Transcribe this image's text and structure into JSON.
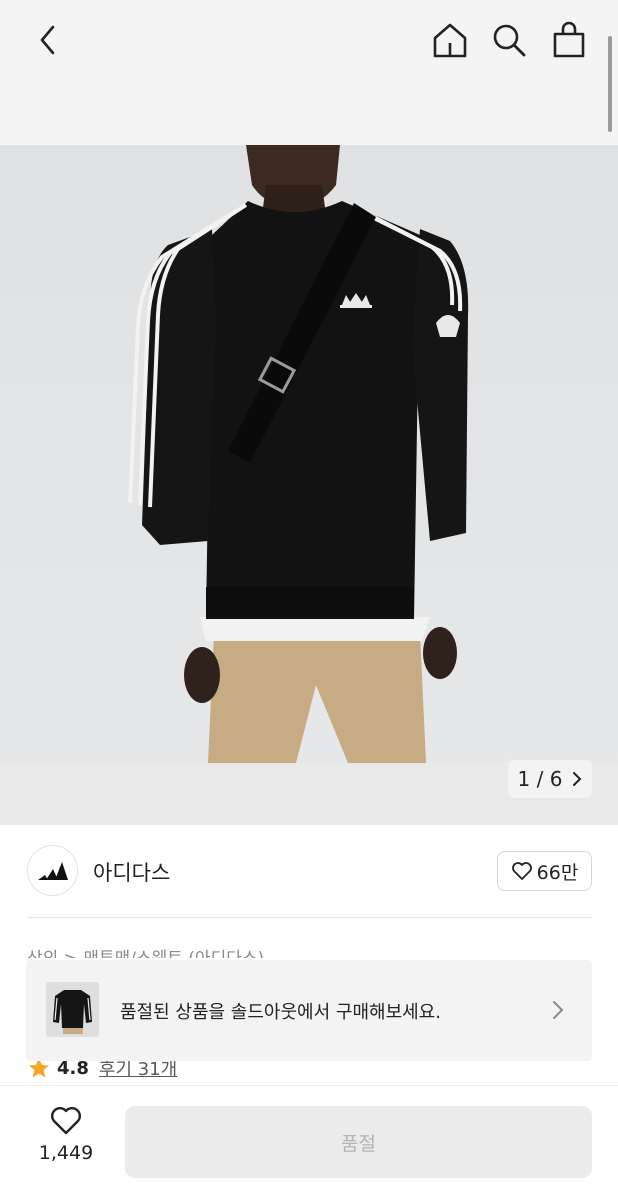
{
  "header": {
    "back_icon": "chevron-left-icon",
    "home_icon": "home-icon",
    "search_icon": "search-icon",
    "bag_icon": "shopping-bag-icon"
  },
  "product_image": {
    "description_icon": "product-photo",
    "counter": "1 / 6"
  },
  "brand": {
    "name": "아디다스",
    "like_count": "66만",
    "logo_icon": "adidas-logo-icon"
  },
  "breadcrumb": {
    "text": "상의 > 맨투맨/스웨트 (아디다스)"
  },
  "rating": {
    "value": "4.8",
    "reviews": "후기 31개",
    "star_color": "#f5a623"
  },
  "soldout_banner": {
    "text": "품절된 상품을 솔드아웃에서 구매해보세요."
  },
  "bottom_bar": {
    "wish_count": "1,449",
    "buy_label": "품절"
  },
  "colors": {
    "header_bg": "#f4f4f4",
    "disabled_button_bg": "#ebebeb",
    "disabled_button_text": "#b3b3b3"
  }
}
